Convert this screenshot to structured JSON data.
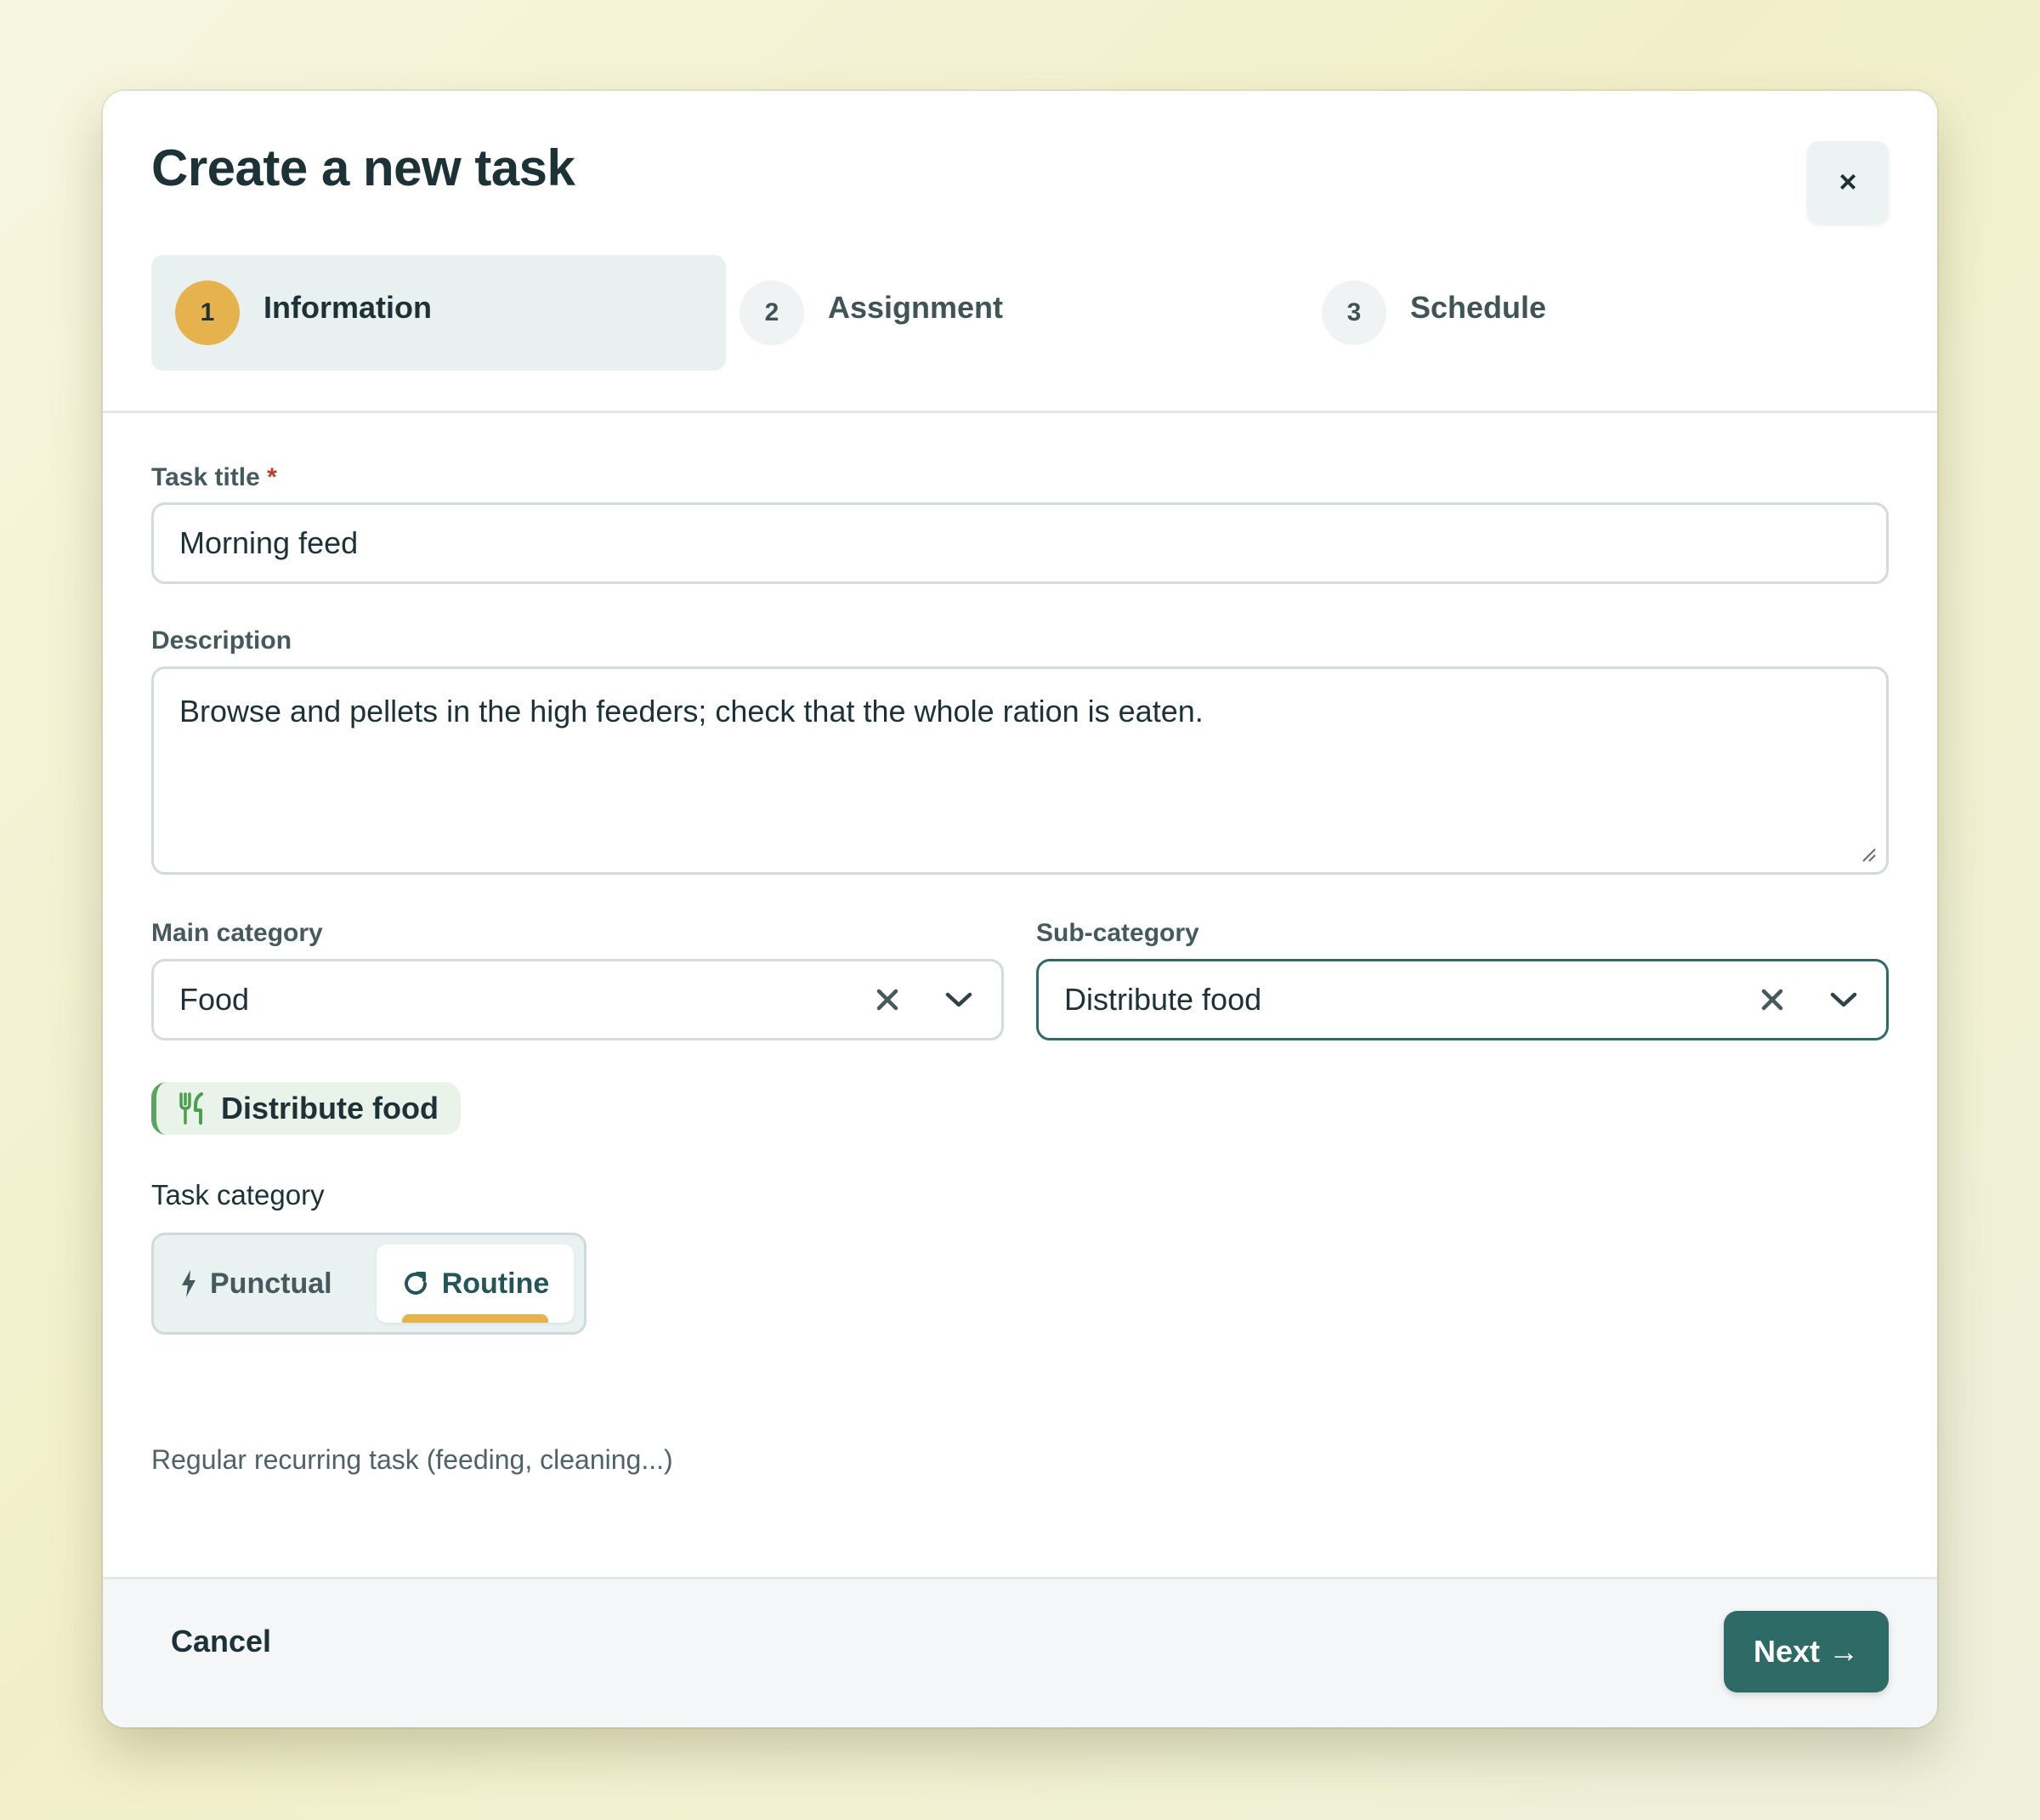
{
  "modal": {
    "title": "Create a new task",
    "close_label": "×"
  },
  "steps": [
    {
      "number": "1",
      "label": "Information",
      "active": true
    },
    {
      "number": "2",
      "label": "Assignment",
      "active": false
    },
    {
      "number": "3",
      "label": "Schedule",
      "active": false
    }
  ],
  "form": {
    "task_title": {
      "label": "Task title",
      "required_marker": "*",
      "value": "Morning feed"
    },
    "description": {
      "label": "Description",
      "value": "Browse and pellets in the high feeders; check that the whole ration is eaten."
    },
    "main_category": {
      "label": "Main category",
      "value": "Food"
    },
    "sub_category": {
      "label": "Sub-category",
      "value": "Distribute food"
    },
    "selected_chip": {
      "label": "Distribute food",
      "icon": "utensils-icon",
      "accent": "#5aa55e"
    },
    "task_category": {
      "label": "Task category",
      "options": [
        {
          "label": "Punctual",
          "icon": "bolt-icon",
          "selected": false
        },
        {
          "label": "Routine",
          "icon": "refresh-icon",
          "selected": true
        }
      ],
      "helper": "Regular recurring task (feeding, cleaning...)"
    }
  },
  "footer": {
    "cancel_label": "Cancel",
    "next_label": "Next",
    "next_arrow": "→"
  },
  "colors": {
    "primary": "#2f6b66",
    "accent": "#e6b24d",
    "text": "#1c3236"
  }
}
